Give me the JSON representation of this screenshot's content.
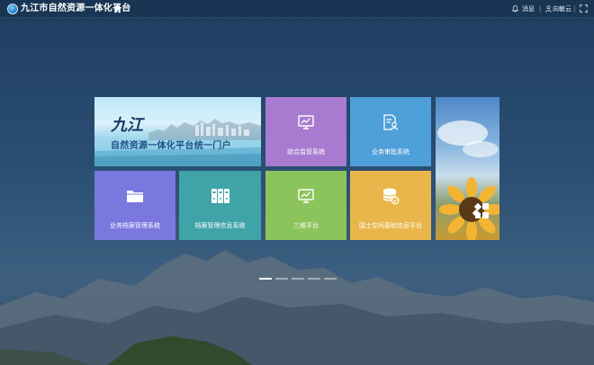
{
  "header": {
    "app_title": "九江市自然资源一体化平台",
    "messages_label": "消息",
    "user_name": "向敏云",
    "separator": "|"
  },
  "banner": {
    "logo_text": "九江",
    "title": "自然资源一体化平台统一门户"
  },
  "tiles": [
    {
      "label": "综合监管系统",
      "color": "#a87bd1",
      "icon": "monitor-chart-icon"
    },
    {
      "label": "业务审批系统",
      "color": "#4f9fd9",
      "icon": "document-user-icon"
    },
    {
      "label": "业务档案管理系统",
      "color": "#7a78df",
      "icon": "folder-icon"
    },
    {
      "label": "档案管理信息系统",
      "color": "#3fa3a7",
      "icon": "binders-icon"
    },
    {
      "label": "三维平台",
      "color": "#8cc45c",
      "icon": "monitor-chart-icon"
    },
    {
      "label": "国土空间基础信息平台",
      "color": "#e9b64c",
      "icon": "database-icon"
    }
  ],
  "carousel": {
    "count": 5,
    "active": 1
  }
}
